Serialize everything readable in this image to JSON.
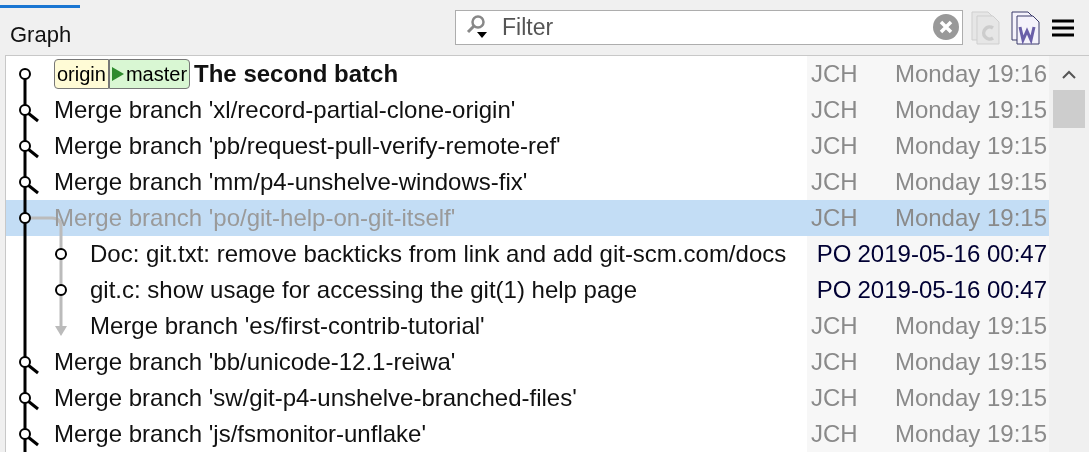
{
  "tab": {
    "label": "Graph",
    "selected": true
  },
  "filter": {
    "placeholder": "Filter"
  },
  "toolbar": [
    {
      "kind": "c-doc",
      "disabled": true
    },
    {
      "kind": "w-doc",
      "disabled": false
    },
    {
      "kind": "menu",
      "disabled": false
    }
  ],
  "commits": [
    {
      "side": false,
      "kind": "plain",
      "refs": [
        {
          "label": "origin",
          "kind": "remote",
          "head": false
        },
        {
          "label": "master",
          "kind": "local",
          "head": true
        }
      ],
      "message": "The second batch",
      "bold": true,
      "selected": false,
      "author": "JCH",
      "date": "Monday 19:16",
      "dimmed": true
    },
    {
      "side": false,
      "kind": "merge",
      "message": "Merge branch 'xl/record-partial-clone-origin'",
      "bold": false,
      "selected": false,
      "author": "JCH",
      "date": "Monday 19:15",
      "dimmed": true
    },
    {
      "side": false,
      "kind": "merge",
      "message": "Merge branch 'pb/request-pull-verify-remote-ref'",
      "bold": false,
      "selected": false,
      "author": "JCH",
      "date": "Monday 19:15",
      "dimmed": true
    },
    {
      "side": false,
      "kind": "merge",
      "message": "Merge branch 'mm/p4-unshelve-windows-fix'",
      "bold": false,
      "selected": false,
      "author": "JCH",
      "date": "Monday 19:15",
      "dimmed": true
    },
    {
      "side": false,
      "kind": "plain",
      "message": "Merge branch 'po/git-help-on-git-itself'",
      "bold": false,
      "selected": true,
      "author": "JCH",
      "date": "Monday 19:15",
      "dimmed": true
    },
    {
      "side": true,
      "kind": "plain",
      "message": "Doc: git.txt: remove backticks from link and add git-scm.com/docs",
      "bold": false,
      "selected": false,
      "author": "PO",
      "date": "2019-05-16 00:47",
      "dimmed": false
    },
    {
      "side": true,
      "kind": "plain",
      "message": "git.c: show usage for accessing the git(1) help page",
      "bold": false,
      "selected": false,
      "author": "PO",
      "date": "2019-05-16 00:47",
      "dimmed": false
    },
    {
      "side": true,
      "kind": "arrow",
      "message": "Merge branch 'es/first-contrib-tutorial'",
      "bold": false,
      "selected": false,
      "author": "JCH",
      "date": "Monday 19:15",
      "dimmed": true
    },
    {
      "side": false,
      "kind": "merge",
      "message": "Merge branch 'bb/unicode-12.1-reiwa'",
      "bold": false,
      "selected": false,
      "author": "JCH",
      "date": "Monday 19:15",
      "dimmed": true
    },
    {
      "side": false,
      "kind": "merge",
      "message": "Merge branch 'sw/git-p4-unshelve-branched-files'",
      "bold": false,
      "selected": false,
      "author": "JCH",
      "date": "Monday 19:15",
      "dimmed": true
    },
    {
      "side": false,
      "kind": "merge",
      "message": "Merge branch 'js/fsmonitor-unflake'",
      "bold": false,
      "selected": false,
      "author": "JCH",
      "date": "Monday 19:15",
      "dimmed": true
    }
  ]
}
